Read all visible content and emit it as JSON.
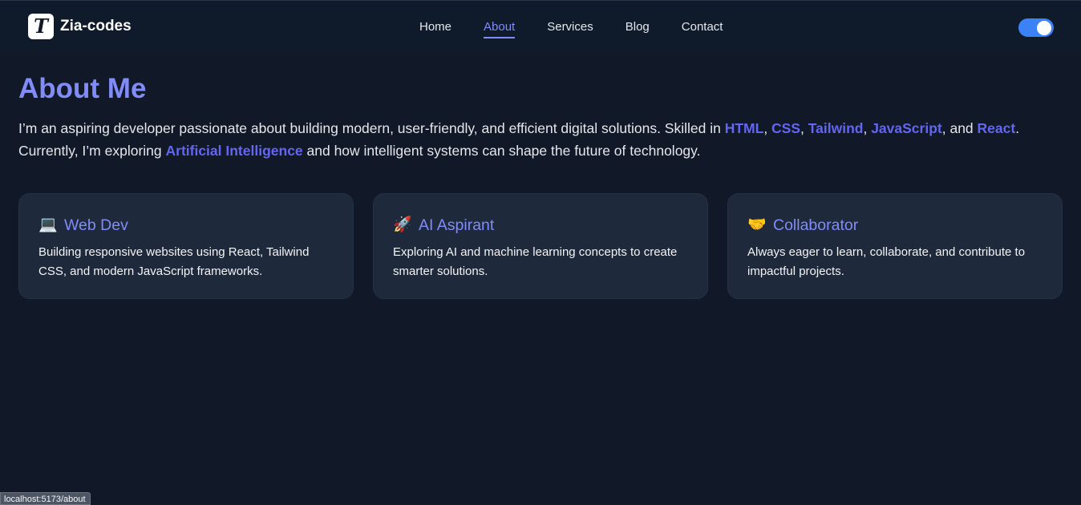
{
  "brand": {
    "logo_letter": "T",
    "name": "Zia-codes"
  },
  "nav": {
    "items": [
      {
        "label": "Home",
        "active": false
      },
      {
        "label": "About",
        "active": true
      },
      {
        "label": "Services",
        "active": false
      },
      {
        "label": "Blog",
        "active": false
      },
      {
        "label": "Contact",
        "active": false
      }
    ],
    "theme_toggle_on": true
  },
  "about": {
    "title": "About Me",
    "intro_part1": "I’m an aspiring developer passionate about building modern, user-friendly, and efficient digital solutions. Skilled in ",
    "skill_html": "HTML",
    "sep1": ", ",
    "skill_css": "CSS",
    "sep2": ", ",
    "skill_tailwind": "Tailwind",
    "sep3": ", ",
    "skill_js": "JavaScript",
    "sep4": ", and ",
    "skill_react": "React",
    "intro_part2": ". Currently, I’m exploring ",
    "ai_highlight": "Artificial Intelligence",
    "intro_part3": " and how intelligent systems can shape the future of technology."
  },
  "cards": [
    {
      "icon": "💻",
      "icon_name": "laptop-icon",
      "title": "Web Dev",
      "text": "Building responsive websites using React, Tailwind CSS, and modern JavaScript frameworks."
    },
    {
      "icon": "🚀",
      "icon_name": "rocket-icon",
      "title": "AI Aspirant",
      "text": "Exploring AI and machine learning concepts to create smarter solutions."
    },
    {
      "icon": "🤝",
      "icon_name": "handshake-icon",
      "title": "Collaborator",
      "text": "Always eager to learn, collaborate, and contribute to impactful projects."
    }
  ],
  "status_bar": {
    "url": "localhost:5173/about"
  },
  "colors": {
    "background": "#111827",
    "navbar": "#0f1a2a",
    "accent": "#818cf8",
    "highlight": "#6366f1",
    "card": "#1e293b",
    "toggle": "#3b82f6"
  }
}
